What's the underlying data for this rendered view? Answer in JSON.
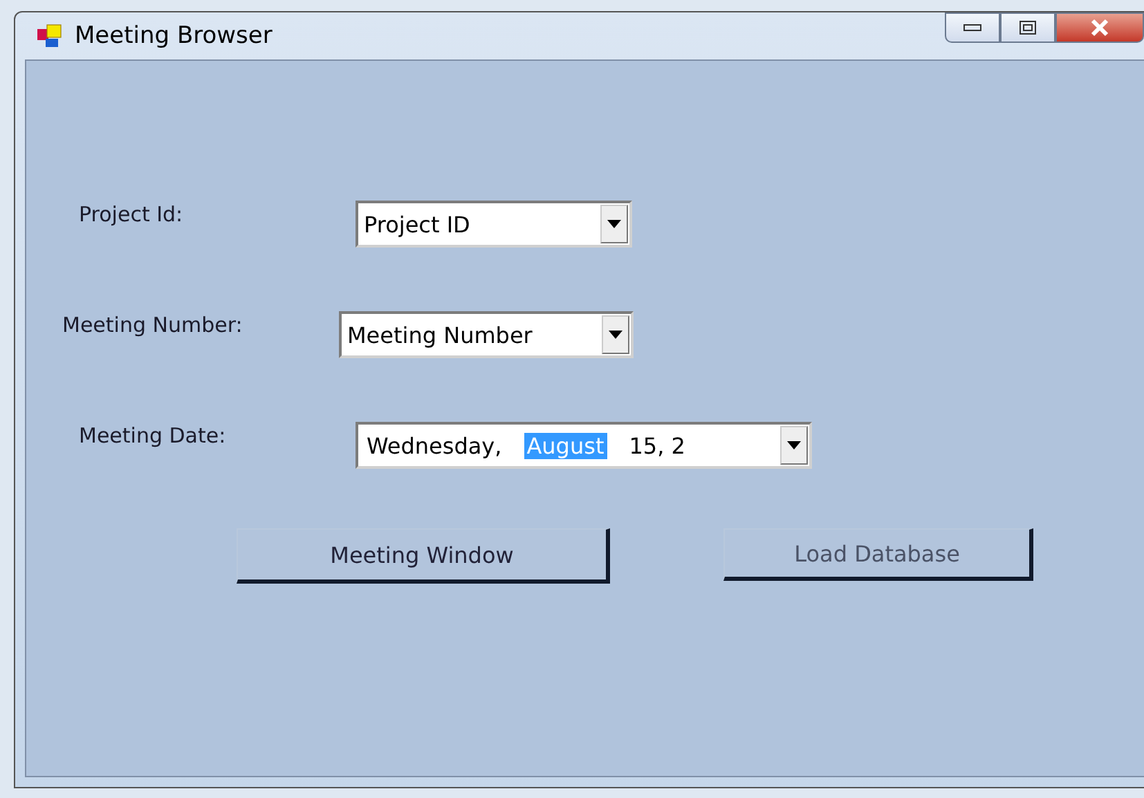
{
  "window": {
    "title": "Meeting Browser"
  },
  "fields": [
    {
      "label": "Project Id:",
      "kind": "combo",
      "value": "Project ID"
    },
    {
      "label": "Meeting Number:",
      "kind": "combo",
      "value": "Meeting Number"
    },
    {
      "label": "Meeting Date:",
      "kind": "date",
      "segments": [
        {
          "text": "Wednesday,",
          "selected": false
        },
        {
          "text": "August",
          "selected": true
        },
        {
          "text": "15, 2",
          "selected": false
        }
      ]
    }
  ],
  "buttons": [
    "Meeting Window",
    "Load Database"
  ]
}
